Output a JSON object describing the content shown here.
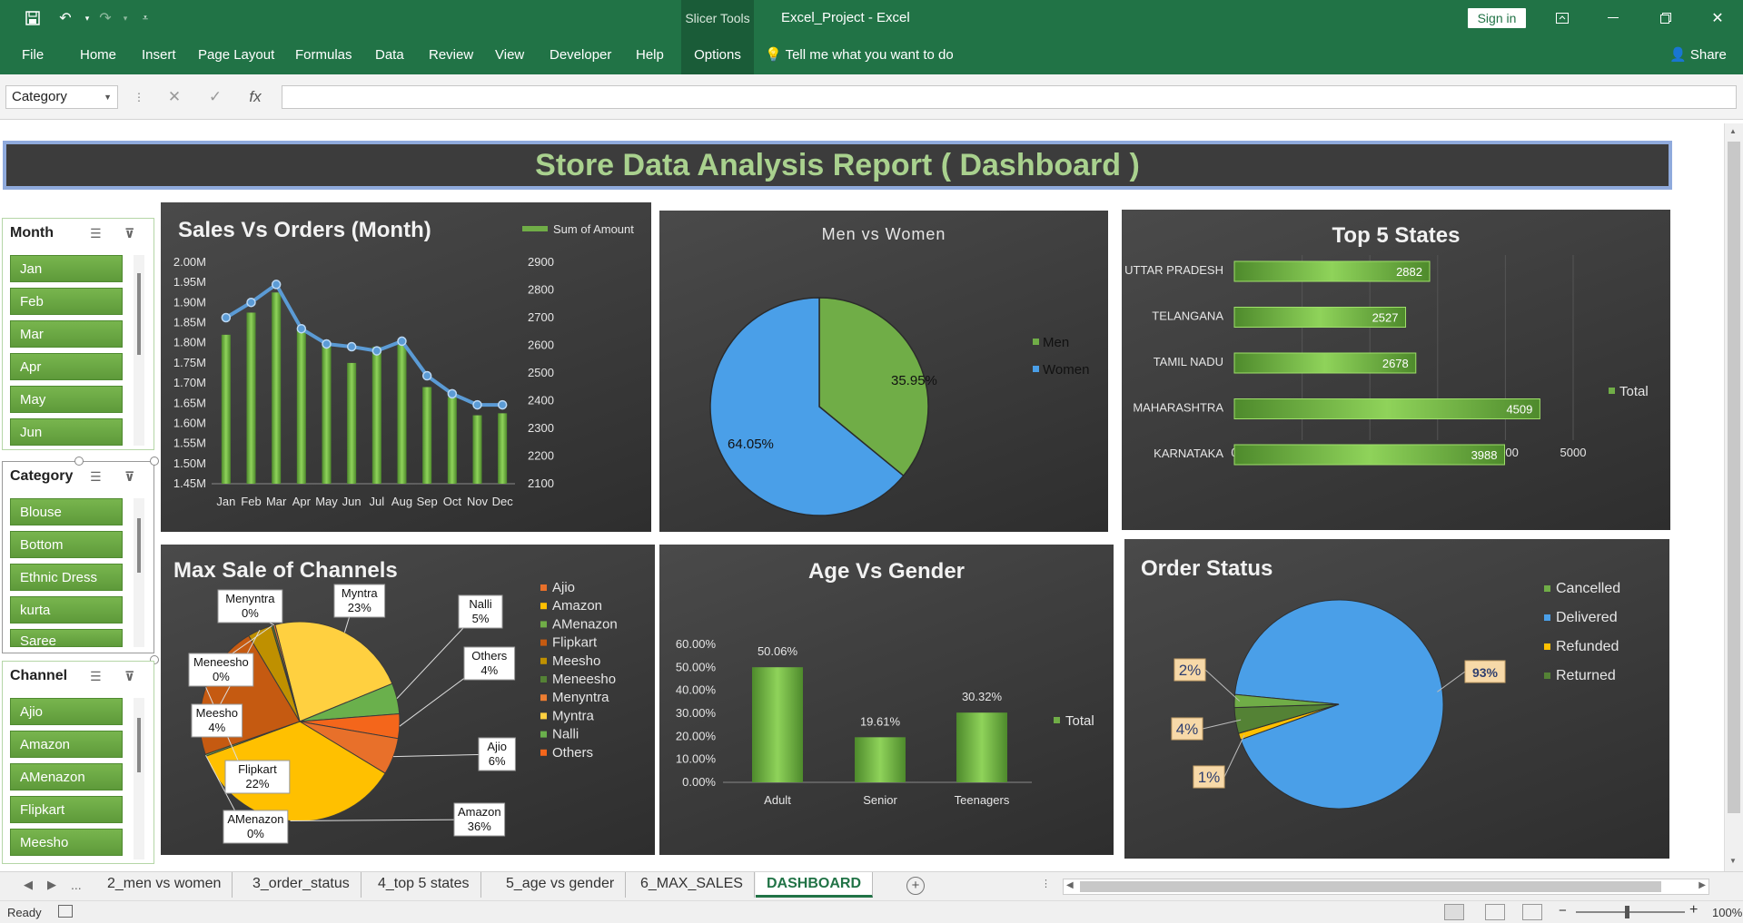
{
  "titlebar": {
    "context_tab": "Slicer Tools",
    "title": "Excel_Project  -  Excel",
    "signin_label": "Sign in",
    "icons": [
      "save-icon",
      "undo-icon",
      "redo-icon",
      "customize-icon",
      "ribbon-display-icon",
      "minimize-icon",
      "restore-icon",
      "close-icon"
    ]
  },
  "ribbon": {
    "tabs": [
      "File",
      "Home",
      "Insert",
      "Page Layout",
      "Formulas",
      "Data",
      "Review",
      "View",
      "Developer",
      "Help",
      "Options"
    ],
    "tell_me": "Tell me what you want to do",
    "share": "Share"
  },
  "formula_bar": {
    "name_box": "Category",
    "fx": "fx",
    "value": ""
  },
  "dashboard": {
    "title": "Store Data Analysis Report ( Dashboard )"
  },
  "slicers": {
    "month": {
      "title": "Month",
      "items": [
        "Jan",
        "Feb",
        "Mar",
        "Apr",
        "May",
        "Jun"
      ]
    },
    "category": {
      "title": "Category",
      "items": [
        "Blouse",
        "Bottom",
        "Ethnic Dress",
        "kurta",
        "Saree"
      ]
    },
    "channel": {
      "title": "Channel",
      "items": [
        "Ajio",
        "Amazon",
        "AMenazon",
        "Flipkart",
        "Meesho"
      ]
    }
  },
  "chart_data": [
    {
      "id": "sales-orders",
      "type": "bar",
      "title": "Sales Vs Orders (Month)",
      "categories": [
        "Jan",
        "Feb",
        "Mar",
        "Apr",
        "May",
        "Jun",
        "Jul",
        "Aug",
        "Sep",
        "Oct",
        "Nov",
        "Dec"
      ],
      "series": [
        {
          "name": "Sum of Amount",
          "type": "bar",
          "values": [
            1820000,
            1875000,
            1925000,
            1830000,
            1800000,
            1750000,
            1790000,
            1795000,
            1690000,
            1665000,
            1620000,
            1625000
          ]
        },
        {
          "type": "line",
          "axis": "secondary",
          "values": [
            2700,
            2755,
            2820,
            2660,
            2605,
            2595,
            2580,
            2615,
            2490,
            2425,
            2385,
            2385
          ]
        }
      ],
      "y_ticks": [
        "2.00M",
        "1.95M",
        "1.90M",
        "1.85M",
        "1.80M",
        "1.75M",
        "1.70M",
        "1.65M",
        "1.60M",
        "1.55M",
        "1.50M",
        "1.45M"
      ],
      "y2_ticks": [
        "2900",
        "2800",
        "2700",
        "2600",
        "2500",
        "2400",
        "2300",
        "2200",
        "2100"
      ],
      "ylim": [
        1450000,
        2000000
      ],
      "y2lim": [
        2100,
        2900
      ],
      "legend": "top-right"
    },
    {
      "id": "men-women",
      "type": "pie",
      "title": "Men vs Women",
      "slices": [
        {
          "label": "Men",
          "value": 35.95,
          "text": "35.95%",
          "color": "#70ad47"
        },
        {
          "label": "Women",
          "value": 64.05,
          "text": "64.05%",
          "color": "#4a9fe8"
        }
      ],
      "legend": "right"
    },
    {
      "id": "top-states",
      "type": "bar",
      "orientation": "horizontal",
      "title": "Top 5 States",
      "categories": [
        "UTTAR PRADESH",
        "TELANGANA",
        "TAMIL NADU",
        "MAHARASHTRA",
        "KARNATAKA"
      ],
      "values": [
        2882,
        2527,
        2678,
        4509,
        3988
      ],
      "x_ticks": [
        "0",
        "1000",
        "2000",
        "3000",
        "4000",
        "5000"
      ],
      "xlim": [
        0,
        5000
      ],
      "legend_label": "Total",
      "legend": "right"
    },
    {
      "id": "max-sale-channels",
      "type": "pie",
      "title": "Max Sale of Channels",
      "slices": [
        {
          "label": "Ajio",
          "value": 6,
          "text": "6%",
          "color": "#e8702a"
        },
        {
          "label": "Amazon",
          "value": 36,
          "text": "36%",
          "color": "#ffc000"
        },
        {
          "label": "AMenazon",
          "value": 0.3,
          "text": "0%",
          "color": "#70ad47"
        },
        {
          "label": "Flipkart",
          "value": 22,
          "text": "22%",
          "color": "#c55a11"
        },
        {
          "label": "Meesho",
          "value": 4,
          "text": "4%",
          "color": "#bf9000"
        },
        {
          "label": "Meneesho",
          "value": 0.3,
          "text": "0%",
          "color": "#548235"
        },
        {
          "label": "Menyntra",
          "value": 0.3,
          "text": "0%",
          "color": "#ed7d31"
        },
        {
          "label": "Myntra",
          "value": 23,
          "text": "23%",
          "color": "#ffd040"
        },
        {
          "label": "Nalli",
          "value": 5,
          "text": "5%",
          "color": "#6ab04c"
        },
        {
          "label": "Others",
          "value": 4,
          "text": "4%",
          "color": "#f4661b"
        }
      ],
      "legend": "right"
    },
    {
      "id": "age-gender",
      "type": "bar",
      "title": "Age Vs Gender",
      "categories": [
        "Adult",
        "Senior",
        "Teenagers"
      ],
      "values": [
        50.06,
        19.61,
        30.32
      ],
      "labels": [
        "50.06%",
        "19.61%",
        "30.32%"
      ],
      "y_ticks": [
        "60.00%",
        "50.00%",
        "40.00%",
        "30.00%",
        "20.00%",
        "10.00%",
        "0.00%"
      ],
      "ylim": [
        0,
        60
      ],
      "legend_label": "Total",
      "legend": "right"
    },
    {
      "id": "order-status",
      "type": "pie",
      "title": "Order Status",
      "slices": [
        {
          "label": "Cancelled",
          "value": 2,
          "text": "2%",
          "color": "#70ad47"
        },
        {
          "label": "Delivered",
          "value": 93,
          "text": "93%",
          "color": "#4a9fe8"
        },
        {
          "label": "Refunded",
          "value": 1,
          "text": "1%",
          "color": "#ffc000"
        },
        {
          "label": "Returned",
          "value": 4,
          "text": "4%",
          "color": "#548235"
        }
      ],
      "legend": "top-right"
    }
  ],
  "sheet_tabs": {
    "more": "...",
    "tabs": [
      "2_men vs women",
      "3_order_status",
      "4_top 5 states",
      "5_age vs gender",
      "6_MAX_SALES"
    ],
    "active": "DASHBOARD"
  },
  "status": {
    "ready": "Ready",
    "zoom": "100%"
  }
}
